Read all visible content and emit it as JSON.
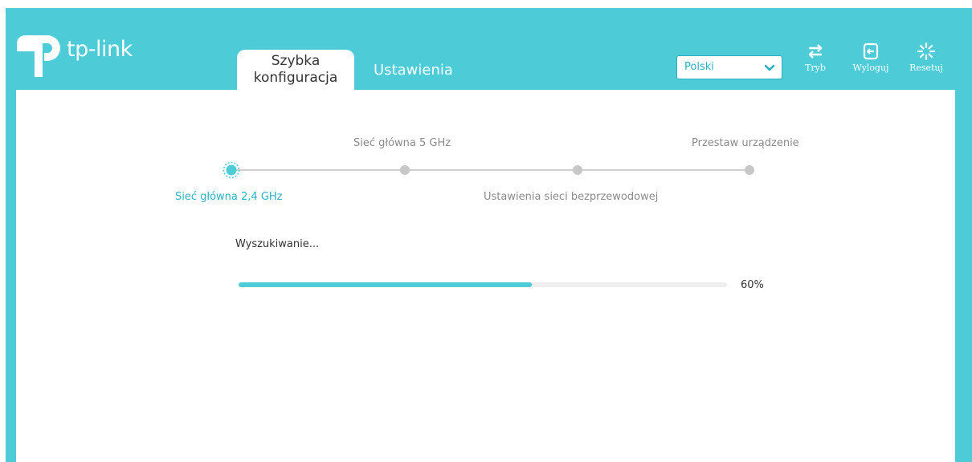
{
  "brand": {
    "logo_text": "tp-link",
    "accent": "#4dcbd7",
    "accent_dark": "#2ab1c0"
  },
  "tabs": [
    {
      "label": "Szybka konfiguracja",
      "active": true
    },
    {
      "label": "Ustawienia",
      "active": false
    }
  ],
  "language": {
    "selected": "Polski"
  },
  "header_buttons": [
    {
      "label": "Tryb",
      "icon": "mode-switch-icon"
    },
    {
      "label": "Wyloguj",
      "icon": "logout-icon"
    },
    {
      "label": "Resetuj",
      "icon": "reboot-icon"
    }
  ],
  "steps": [
    {
      "label": "Sieć główna 2,4 GHz",
      "state": "active"
    },
    {
      "label": "Sieć główna 5 GHz",
      "state": "pending"
    },
    {
      "label": "Ustawienia sieci bezprzewodowej",
      "state": "pending"
    },
    {
      "label": "Przestaw urządzenie",
      "state": "pending"
    }
  ],
  "progress": {
    "status_text": "Wyszukiwanie...",
    "value": 60,
    "value_label": "60%"
  }
}
